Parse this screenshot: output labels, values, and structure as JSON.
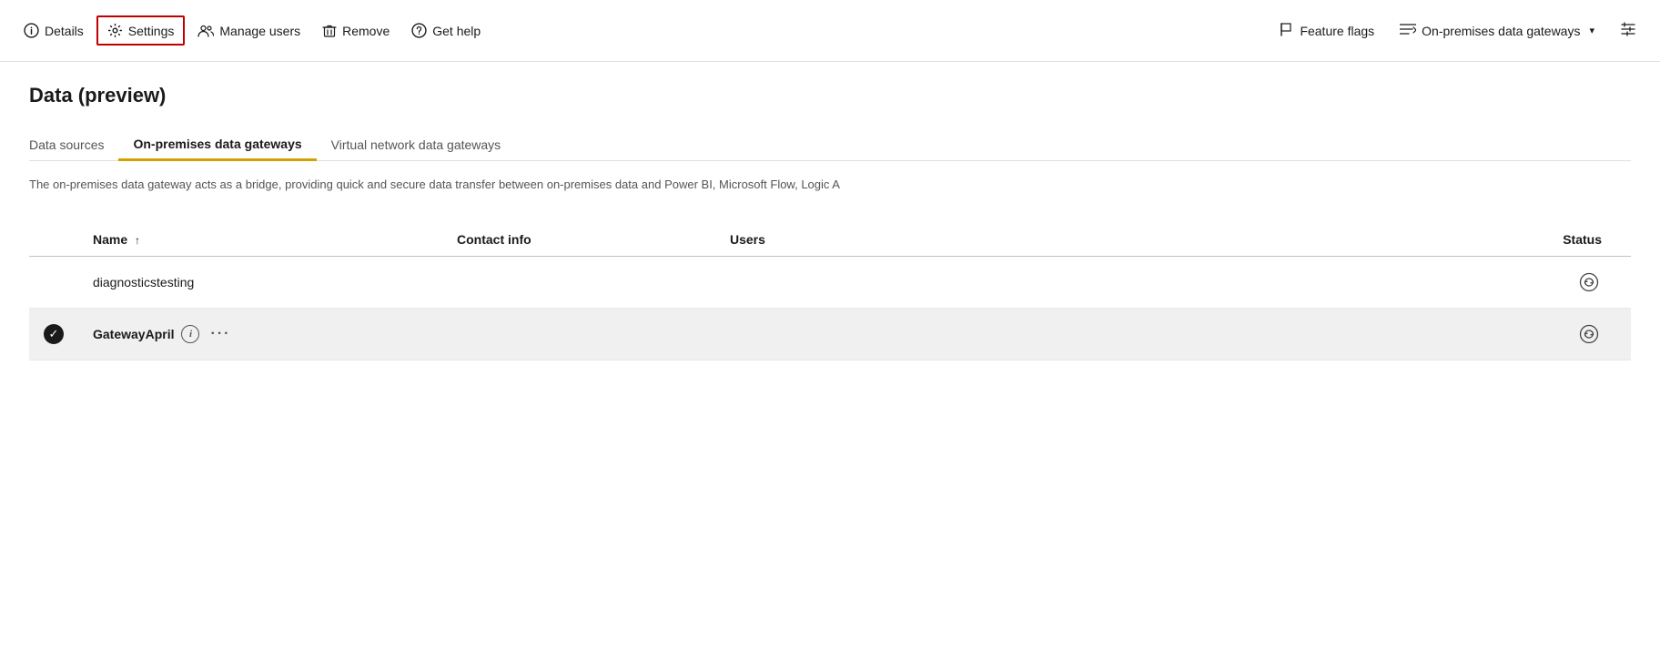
{
  "toolbar": {
    "details_label": "Details",
    "settings_label": "Settings",
    "manage_users_label": "Manage users",
    "remove_label": "Remove",
    "get_help_label": "Get help",
    "feature_flags_label": "Feature flags",
    "on_premises_label": "On-premises data gateways",
    "filter_icon": "filter-icon"
  },
  "page": {
    "title": "Data (preview)"
  },
  "tabs": [
    {
      "id": "data-sources",
      "label": "Data sources",
      "active": false
    },
    {
      "id": "on-premises",
      "label": "On-premises data gateways",
      "active": true
    },
    {
      "id": "virtual-network",
      "label": "Virtual network data gateways",
      "active": false
    }
  ],
  "description": "The on-premises data gateway acts as a bridge, providing quick and secure data transfer between on-premises data and Power BI, Microsoft Flow, Logic A",
  "table": {
    "columns": [
      {
        "id": "select",
        "label": ""
      },
      {
        "id": "name",
        "label": "Name",
        "sort": "asc"
      },
      {
        "id": "contact",
        "label": "Contact info"
      },
      {
        "id": "users",
        "label": "Users"
      },
      {
        "id": "status",
        "label": "Status"
      }
    ],
    "rows": [
      {
        "id": "row-1",
        "selected": false,
        "name": "diagnosticstesting",
        "contact": "",
        "users": "",
        "status": "sync"
      },
      {
        "id": "row-2",
        "selected": true,
        "name": "GatewayApril",
        "contact": "",
        "users": "",
        "status": "sync"
      }
    ]
  }
}
